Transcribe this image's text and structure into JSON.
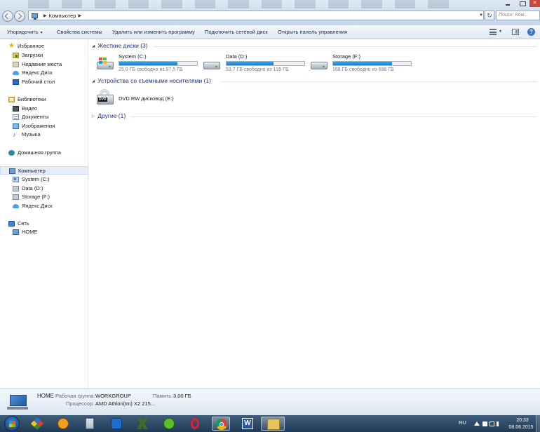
{
  "window": {
    "address": {
      "breadcrumb": "Компьютер"
    },
    "search": {
      "placeholder": "Поиск: Ком..."
    }
  },
  "toolbar": {
    "organize_label": "Упорядочить",
    "system_properties_label": "Свойства системы",
    "uninstall_label": "Удалить или изменить программу",
    "map_drive_label": "Подключить сетевой диск",
    "control_panel_label": "Открыть панель управления"
  },
  "sidebar": {
    "favorites": {
      "label": "Избранное",
      "items": [
        {
          "label": "Загрузки",
          "icon": "downloads-folder-icon"
        },
        {
          "label": "Недавние места",
          "icon": "recent-places-icon"
        },
        {
          "label": "Яндекс.Диск",
          "icon": "yandex-disk-icon"
        },
        {
          "label": "Рабочий стол",
          "icon": "desktop-icon"
        }
      ]
    },
    "libraries": {
      "label": "Библиотеки",
      "items": [
        {
          "label": "Видео",
          "icon": "video-icon"
        },
        {
          "label": "Документы",
          "icon": "documents-icon"
        },
        {
          "label": "Изображения",
          "icon": "pictures-icon"
        },
        {
          "label": "Музыка",
          "icon": "music-icon"
        }
      ]
    },
    "homegroup": {
      "label": "Домашняя группа"
    },
    "computer": {
      "label": "Компьютер",
      "items": [
        {
          "label": "System (C:)",
          "icon": "windows-drive-icon"
        },
        {
          "label": "Data (D:)",
          "icon": "drive-icon"
        },
        {
          "label": "Storage (F:)",
          "icon": "drive-icon"
        },
        {
          "label": "Яндекс.Диск",
          "icon": "yandex-disk-icon"
        }
      ]
    },
    "network": {
      "label": "Сеть",
      "items": [
        {
          "label": "HOME",
          "icon": "network-computer-icon"
        }
      ]
    }
  },
  "content": {
    "groups": {
      "hard_drives": "Жесткие диски (3)",
      "removable": "Устройства со съемными носителями (1)",
      "other": "Другие (1)"
    },
    "drives": [
      {
        "name": "System (C:)",
        "free_text": "25,0 ГБ свободно из 97,5 ГБ",
        "used_fraction": 0.744,
        "is_system": true
      },
      {
        "name": "Data (D:)",
        "free_text": "53,7 ГБ свободно из 135 ГБ",
        "used_fraction": 0.602,
        "is_system": false
      },
      {
        "name": "Storage (F:)",
        "free_text": "168 ГБ свободно из 698 ГБ",
        "used_fraction": 0.759,
        "is_system": false
      }
    ],
    "removable_devices": [
      {
        "name": "DVD RW дисковод (E:)",
        "badge": "DVD"
      }
    ]
  },
  "details": {
    "name": "HOME",
    "workgroup_label": "Рабочая группа:",
    "workgroup_value": "WORKGROUP",
    "memory_label": "Память:",
    "memory_value": "3,00 ГБ",
    "processor_label": "Процессор:",
    "processor_value": "AMD Athlon(tm) X2 215..."
  },
  "taskbar": {
    "apps": [
      "start-orb",
      "archiver",
      "aimp",
      "calculator",
      "maxthon",
      "generic-app",
      "utorrent",
      "opera",
      "chrome",
      "word",
      "explorer"
    ],
    "active_app": "explorer",
    "lang": "RU",
    "time": "20:33",
    "date": "08.06.2015"
  },
  "colors": {
    "group_heading": "#1e3287",
    "usage_bar": "#1f7cc0",
    "taskbar": "#1f3a56"
  }
}
